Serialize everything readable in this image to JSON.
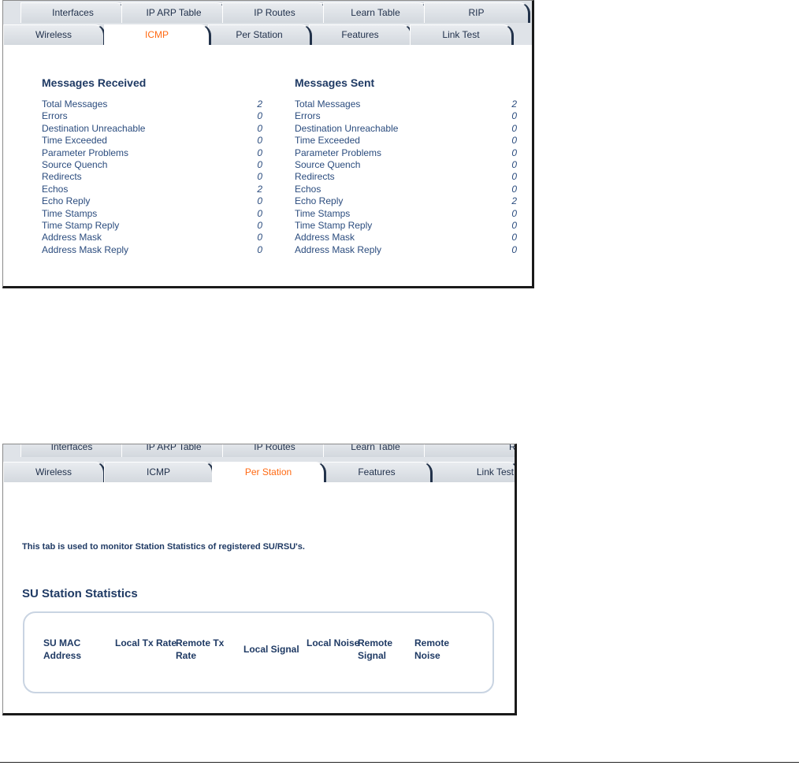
{
  "panel1": {
    "tabs_row1": [
      "Interfaces",
      "IP ARP Table",
      "IP Routes",
      "Learn Table",
      "RIP"
    ],
    "tabs_row2": [
      "Wireless",
      "ICMP",
      "Per Station",
      "Features",
      "Link Test"
    ],
    "active_tab": "ICMP",
    "received": {
      "heading": "Messages Received",
      "rows": [
        {
          "label": "Total Messages",
          "value": "2"
        },
        {
          "label": "Errors",
          "value": "0"
        },
        {
          "label": "Destination Unreachable",
          "value": "0"
        },
        {
          "label": "Time Exceeded",
          "value": "0"
        },
        {
          "label": "Parameter Problems",
          "value": "0"
        },
        {
          "label": "Source Quench",
          "value": "0"
        },
        {
          "label": "Redirects",
          "value": "0"
        },
        {
          "label": "Echos",
          "value": "2"
        },
        {
          "label": "Echo Reply",
          "value": "0"
        },
        {
          "label": "Time Stamps",
          "value": "0"
        },
        {
          "label": "Time Stamp Reply",
          "value": "0"
        },
        {
          "label": "Address Mask",
          "value": "0"
        },
        {
          "label": "Address Mask Reply",
          "value": "0"
        }
      ]
    },
    "sent": {
      "heading": "Messages Sent",
      "rows": [
        {
          "label": "Total Messages",
          "value": "2"
        },
        {
          "label": "Errors",
          "value": "0"
        },
        {
          "label": "Destination Unreachable",
          "value": "0"
        },
        {
          "label": "Time Exceeded",
          "value": "0"
        },
        {
          "label": "Parameter Problems",
          "value": "0"
        },
        {
          "label": "Source Quench",
          "value": "0"
        },
        {
          "label": "Redirects",
          "value": "0"
        },
        {
          "label": "Echos",
          "value": "0"
        },
        {
          "label": "Echo Reply",
          "value": "2"
        },
        {
          "label": "Time Stamps",
          "value": "0"
        },
        {
          "label": "Time Stamp Reply",
          "value": "0"
        },
        {
          "label": "Address Mask",
          "value": "0"
        },
        {
          "label": "Address Mask Reply",
          "value": "0"
        }
      ]
    }
  },
  "panel2": {
    "tabs_row1": [
      "Interfaces",
      "IP ARP Table",
      "IP Routes",
      "Learn Table",
      "RIP"
    ],
    "tabs_row2": [
      "Wireless",
      "ICMP",
      "Per Station",
      "Features",
      "Link Test"
    ],
    "active_tab": "Per Station",
    "description": "This tab is used to monitor Station Statistics of registered SU/RSU's.",
    "section_title": "SU Station Statistics",
    "columns": [
      "SU MAC Address",
      "Local Tx Rate",
      "Remote Tx Rate",
      "Local Signal",
      "Local Noise",
      "Remote Signal",
      "Remote Noise"
    ]
  },
  "colors": {
    "active_tab_text": "#ff6a13",
    "label_text": "#2b4c7e",
    "heading_text": "#1f3a64"
  }
}
